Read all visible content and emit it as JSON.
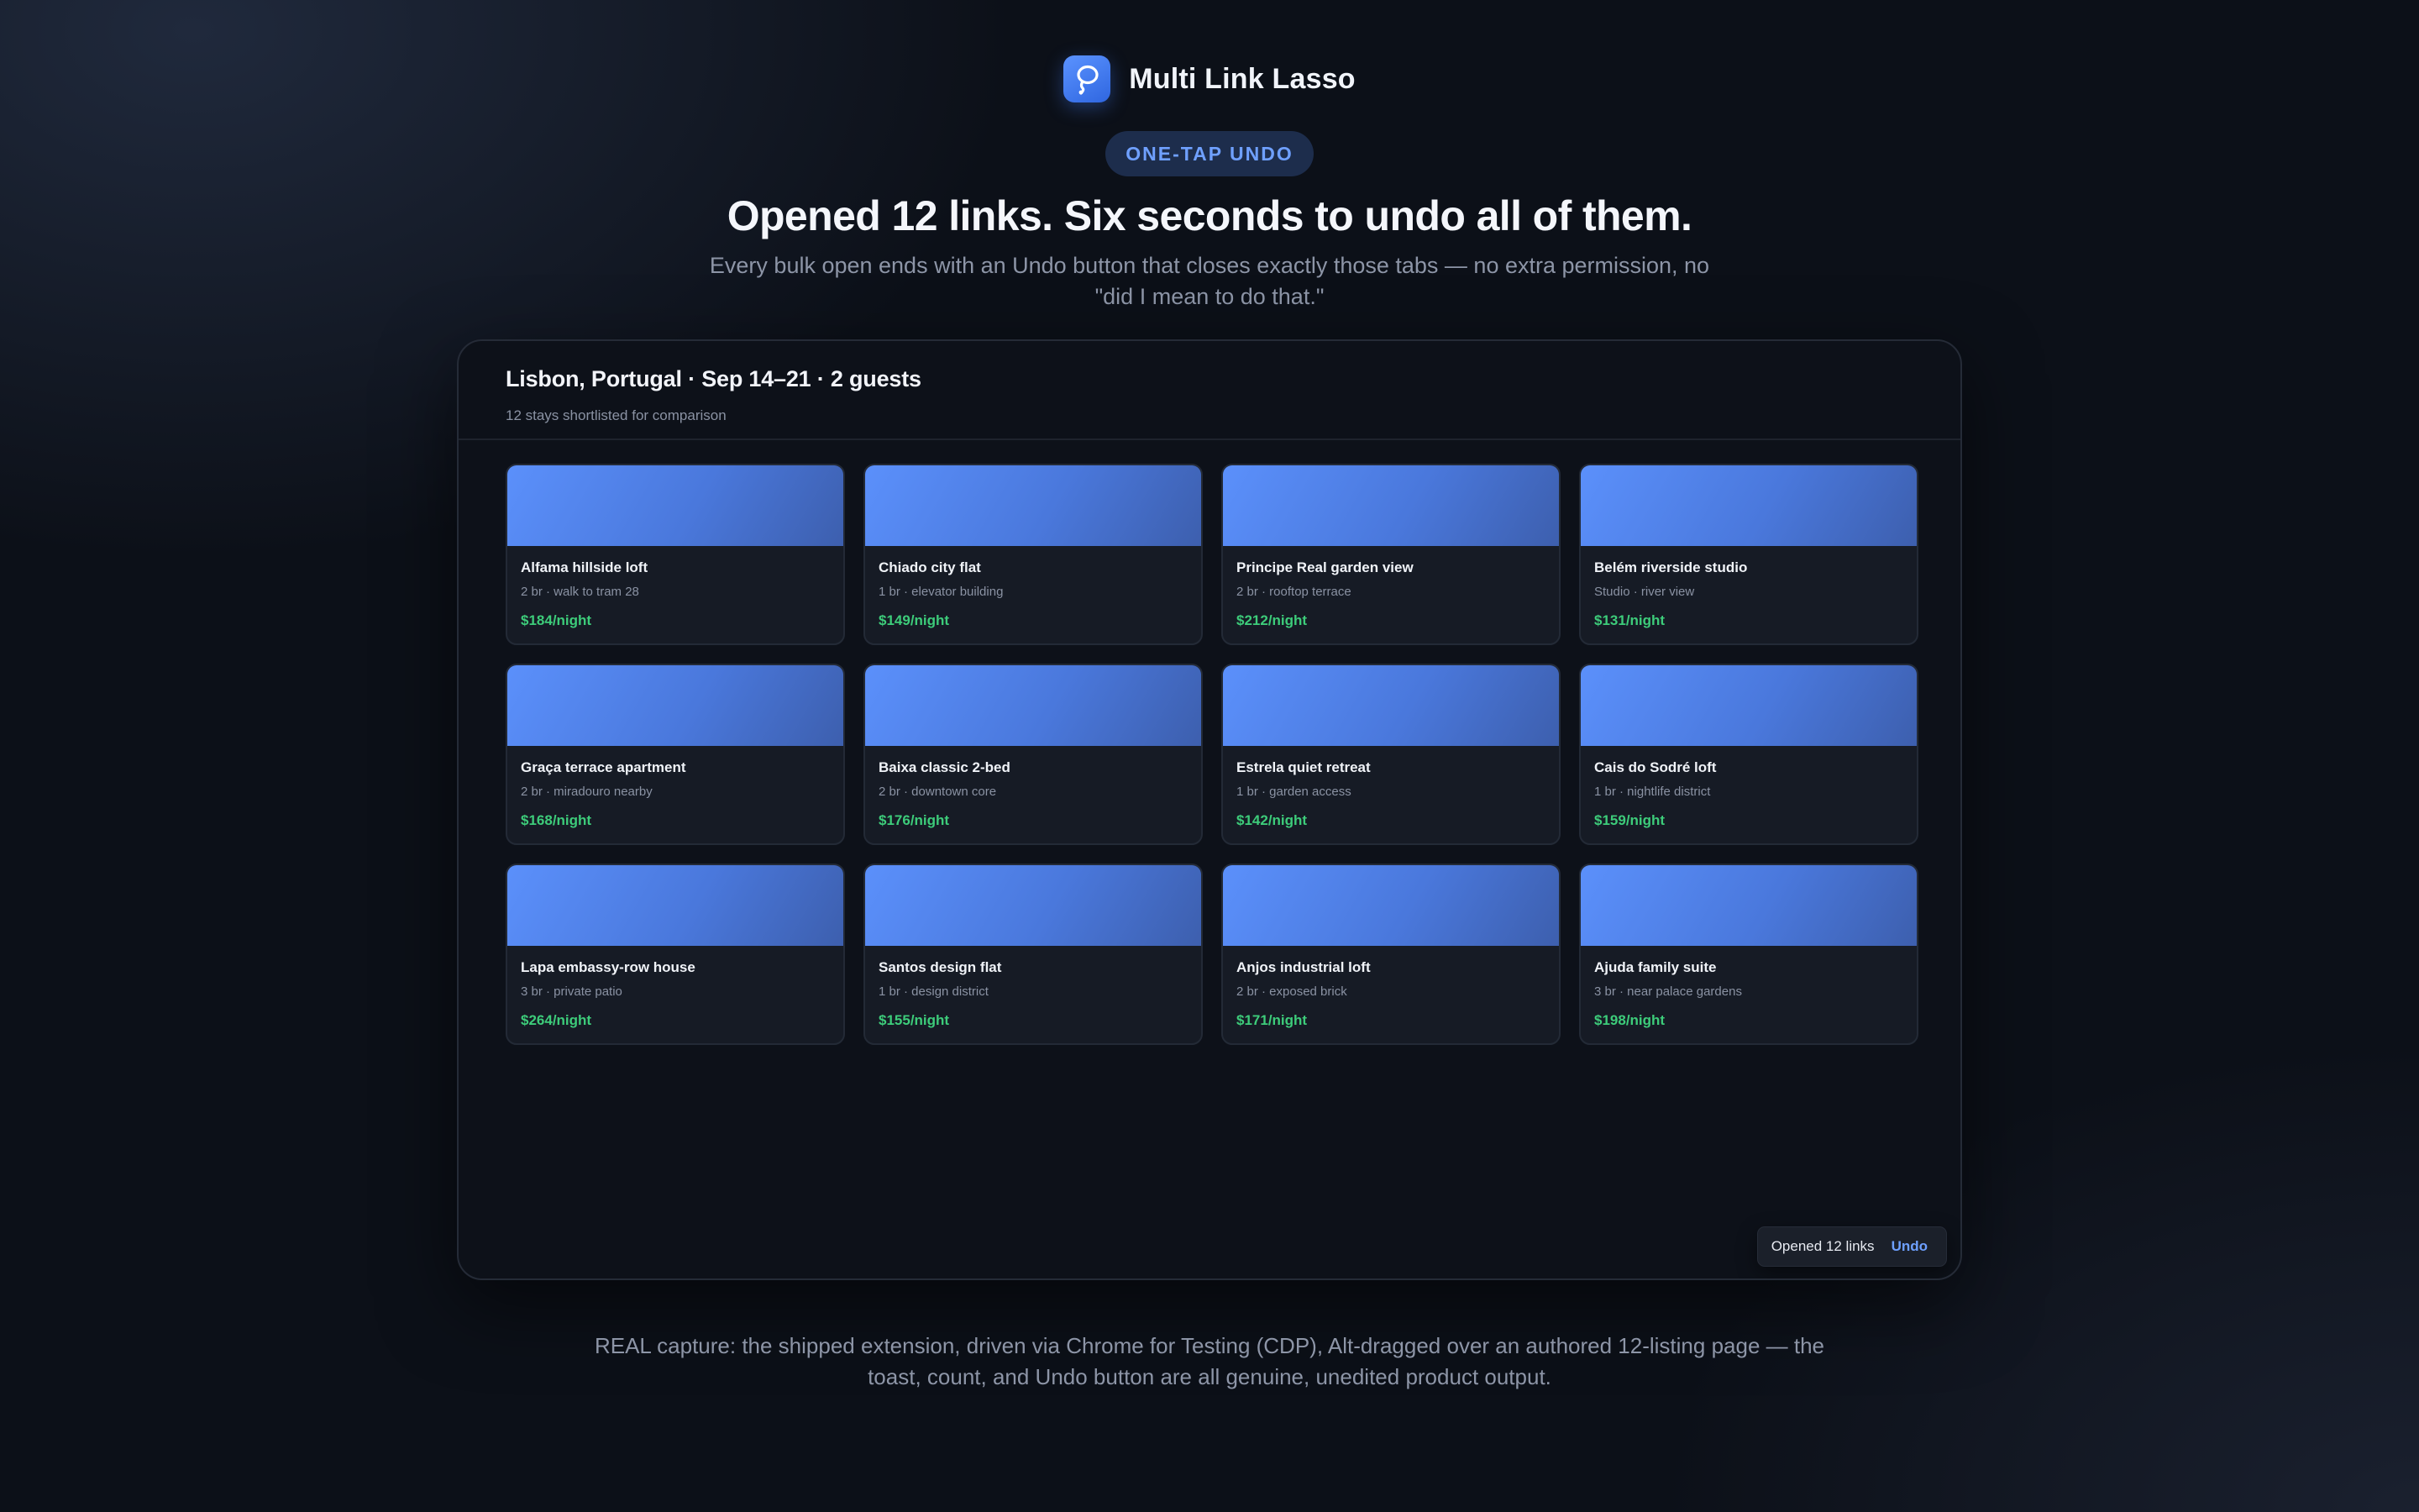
{
  "brand": {
    "name": "Multi Link Lasso",
    "icon": "lasso-icon"
  },
  "badge": "ONE-TAP UNDO",
  "headline": "Opened 12 links. Six seconds to undo all of them.",
  "subhead": "Every bulk open ends with an Undo button that closes exactly those tabs — no extra permission, no \"did I mean to do that.\"",
  "window": {
    "title": "Lisbon, Portugal · Sep 14–21 · 2 guests",
    "subtitle": "12 stays shortlisted for comparison",
    "listings": [
      {
        "name": "Alfama hillside loft",
        "meta": "2 br · walk to tram 28",
        "price": "$184/night"
      },
      {
        "name": "Chiado city flat",
        "meta": "1 br · elevator building",
        "price": "$149/night"
      },
      {
        "name": "Principe Real garden view",
        "meta": "2 br · rooftop terrace",
        "price": "$212/night"
      },
      {
        "name": "Belém riverside studio",
        "meta": "Studio · river view",
        "price": "$131/night"
      },
      {
        "name": "Graça terrace apartment",
        "meta": "2 br · miradouro nearby",
        "price": "$168/night"
      },
      {
        "name": "Baixa classic 2-bed",
        "meta": "2 br · downtown core",
        "price": "$176/night"
      },
      {
        "name": "Estrela quiet retreat",
        "meta": "1 br · garden access",
        "price": "$142/night"
      },
      {
        "name": "Cais do Sodré loft",
        "meta": "1 br · nightlife district",
        "price": "$159/night"
      },
      {
        "name": "Lapa embassy-row house",
        "meta": "3 br · private patio",
        "price": "$264/night"
      },
      {
        "name": "Santos design flat",
        "meta": "1 br · design district",
        "price": "$155/night"
      },
      {
        "name": "Anjos industrial loft",
        "meta": "2 br · exposed brick",
        "price": "$171/night"
      },
      {
        "name": "Ajuda family suite",
        "meta": "3 br · near palace gardens",
        "price": "$198/night"
      }
    ],
    "toast": {
      "text": "Opened 12 links",
      "action": "Undo"
    }
  },
  "caption": "REAL capture: the shipped extension, driven via Chrome for Testing (CDP), Alt-dragged over an authored 12-listing page — the toast, count, and Undo button are all genuine, unedited product output.",
  "colors": {
    "accent": "#5b93ff",
    "price": "#3dcc7a",
    "undo": "#6ea0ff",
    "background": "#0c1018"
  }
}
